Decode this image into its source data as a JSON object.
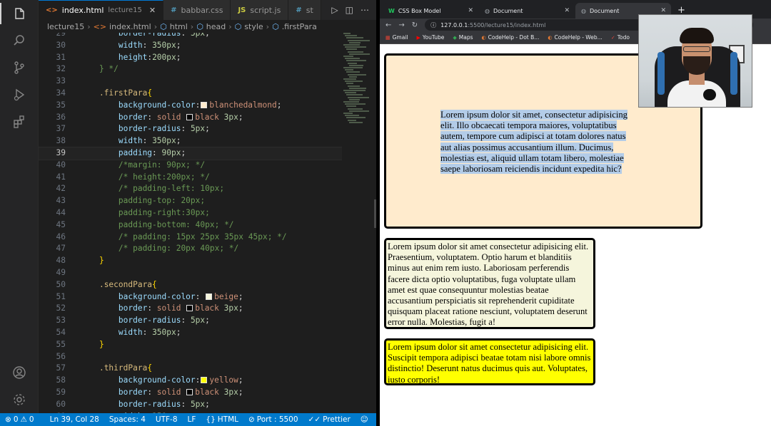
{
  "editor": {
    "tabs": [
      {
        "icon": "<>",
        "label": "index.html",
        "sub": "lecture15",
        "active": true
      },
      {
        "icon": "#",
        "label": "babbar.css",
        "sub": "",
        "active": false
      },
      {
        "icon": "JS",
        "label": "script.js",
        "sub": "",
        "active": false
      },
      {
        "icon": "#",
        "label": "st",
        "sub": "",
        "active": false
      }
    ],
    "breadcrumb": [
      "lecture15",
      "index.html",
      "html",
      "head",
      "style",
      ".firstPara"
    ],
    "lines": [
      {
        "n": "29",
        "indent": "        ",
        "tokens": [
          [
            "prop",
            "border-radius"
          ],
          [
            "punc",
            ": "
          ],
          [
            "num",
            "5px"
          ],
          [
            "punc",
            ";"
          ]
        ]
      },
      {
        "n": "30",
        "indent": "        ",
        "tokens": [
          [
            "prop",
            "width"
          ],
          [
            "punc",
            ": "
          ],
          [
            "num",
            "350px"
          ],
          [
            "punc",
            ";"
          ]
        ]
      },
      {
        "n": "31",
        "indent": "        ",
        "tokens": [
          [
            "prop",
            "height"
          ],
          [
            "punc",
            ":"
          ],
          [
            "num",
            "200px"
          ],
          [
            "punc",
            ";"
          ]
        ]
      },
      {
        "n": "32",
        "indent": "    ",
        "tokens": [
          [
            "com",
            "} */"
          ]
        ]
      },
      {
        "n": "33",
        "indent": "",
        "tokens": []
      },
      {
        "n": "34",
        "indent": "    ",
        "tokens": [
          [
            "sel",
            ".firstPara"
          ],
          [
            "brace",
            "{"
          ]
        ]
      },
      {
        "n": "35",
        "indent": "        ",
        "tokens": [
          [
            "prop",
            "background-color"
          ],
          [
            "punc",
            ":"
          ],
          [
            "swatch",
            "#ffebcd"
          ],
          [
            "val",
            "blanchedalmond"
          ],
          [
            "punc",
            ";"
          ]
        ]
      },
      {
        "n": "36",
        "indent": "        ",
        "tokens": [
          [
            "prop",
            "border"
          ],
          [
            "punc",
            ": "
          ],
          [
            "val",
            "solid "
          ],
          [
            "swatch",
            "#000000"
          ],
          [
            "val",
            "black "
          ],
          [
            "num",
            "3px"
          ],
          [
            "punc",
            ";"
          ]
        ]
      },
      {
        "n": "37",
        "indent": "        ",
        "tokens": [
          [
            "prop",
            "border-radius"
          ],
          [
            "punc",
            ": "
          ],
          [
            "num",
            "5px"
          ],
          [
            "punc",
            ";"
          ]
        ]
      },
      {
        "n": "38",
        "indent": "        ",
        "tokens": [
          [
            "prop",
            "width"
          ],
          [
            "punc",
            ": "
          ],
          [
            "num",
            "350px"
          ],
          [
            "punc",
            ";"
          ]
        ]
      },
      {
        "n": "39",
        "indent": "        ",
        "tokens": [
          [
            "prop",
            "padding"
          ],
          [
            "punc",
            ": "
          ],
          [
            "num",
            "90px"
          ],
          [
            "punc",
            ";"
          ]
        ],
        "current": true
      },
      {
        "n": "40",
        "indent": "        ",
        "tokens": [
          [
            "com",
            "/*margin: 90px; */"
          ]
        ]
      },
      {
        "n": "41",
        "indent": "        ",
        "tokens": [
          [
            "com",
            "/* height:200px; */"
          ]
        ]
      },
      {
        "n": "42",
        "indent": "        ",
        "tokens": [
          [
            "com",
            "/* padding-left: 10px;"
          ]
        ]
      },
      {
        "n": "43",
        "indent": "        ",
        "tokens": [
          [
            "com",
            "padding-top: 20px;"
          ]
        ]
      },
      {
        "n": "44",
        "indent": "        ",
        "tokens": [
          [
            "com",
            "padding-right:30px;"
          ]
        ]
      },
      {
        "n": "45",
        "indent": "        ",
        "tokens": [
          [
            "com",
            "padding-bottom: 40px; */"
          ]
        ]
      },
      {
        "n": "46",
        "indent": "        ",
        "tokens": [
          [
            "com",
            "/* padding: 15px 25px 35px 45px; */"
          ]
        ]
      },
      {
        "n": "47",
        "indent": "        ",
        "tokens": [
          [
            "com",
            "/* padding: 20px 40px; */"
          ]
        ]
      },
      {
        "n": "48",
        "indent": "    ",
        "tokens": [
          [
            "brace",
            "}"
          ]
        ]
      },
      {
        "n": "49",
        "indent": "",
        "tokens": []
      },
      {
        "n": "50",
        "indent": "    ",
        "tokens": [
          [
            "sel",
            ".secondPara"
          ],
          [
            "brace",
            "{"
          ]
        ]
      },
      {
        "n": "51",
        "indent": "        ",
        "tokens": [
          [
            "prop",
            "background-color"
          ],
          [
            "punc",
            ": "
          ],
          [
            "swatch",
            "#f5f5dc"
          ],
          [
            "val",
            "beige"
          ],
          [
            "punc",
            ";"
          ]
        ]
      },
      {
        "n": "52",
        "indent": "        ",
        "tokens": [
          [
            "prop",
            "border"
          ],
          [
            "punc",
            ": "
          ],
          [
            "val",
            "solid "
          ],
          [
            "swatch",
            "#000000"
          ],
          [
            "val",
            "black "
          ],
          [
            "num",
            "3px"
          ],
          [
            "punc",
            ";"
          ]
        ]
      },
      {
        "n": "53",
        "indent": "        ",
        "tokens": [
          [
            "prop",
            "border-radius"
          ],
          [
            "punc",
            ": "
          ],
          [
            "num",
            "5px"
          ],
          [
            "punc",
            ";"
          ]
        ]
      },
      {
        "n": "54",
        "indent": "        ",
        "tokens": [
          [
            "prop",
            "width"
          ],
          [
            "punc",
            ": "
          ],
          [
            "num",
            "350px"
          ],
          [
            "punc",
            ";"
          ]
        ]
      },
      {
        "n": "55",
        "indent": "    ",
        "tokens": [
          [
            "brace",
            "}"
          ]
        ]
      },
      {
        "n": "56",
        "indent": "",
        "tokens": []
      },
      {
        "n": "57",
        "indent": "    ",
        "tokens": [
          [
            "sel",
            ".thirdPara"
          ],
          [
            "brace",
            "{"
          ]
        ]
      },
      {
        "n": "58",
        "indent": "        ",
        "tokens": [
          [
            "prop",
            "background-color"
          ],
          [
            "punc",
            ":"
          ],
          [
            "swatch",
            "#ffff00"
          ],
          [
            "val",
            "yellow"
          ],
          [
            "punc",
            ";"
          ]
        ]
      },
      {
        "n": "59",
        "indent": "        ",
        "tokens": [
          [
            "prop",
            "border"
          ],
          [
            "punc",
            ": "
          ],
          [
            "val",
            "solid "
          ],
          [
            "swatch",
            "#000000"
          ],
          [
            "val",
            "black "
          ],
          [
            "num",
            "3px"
          ],
          [
            "punc",
            ";"
          ]
        ]
      },
      {
        "n": "60",
        "indent": "        ",
        "tokens": [
          [
            "prop",
            "border-radius"
          ],
          [
            "punc",
            ": "
          ],
          [
            "num",
            "5px"
          ],
          [
            "punc",
            ";"
          ]
        ]
      },
      {
        "n": "61",
        "indent": "        ",
        "tokens": [
          [
            "prop",
            "width"
          ],
          [
            "punc",
            ": "
          ],
          [
            "num",
            "350px"
          ],
          [
            "punc",
            ";"
          ]
        ]
      }
    ],
    "status": {
      "errors": "0",
      "warnings": "0",
      "position": "Ln 39, Col 28",
      "spaces": "Spaces: 4",
      "encoding": "UTF-8",
      "eol": "LF",
      "language": "HTML",
      "port": "Port : 5500",
      "prettier": "Prettier"
    }
  },
  "browser": {
    "tabs": [
      {
        "favicon": "W",
        "title": "CSS Box Model",
        "active": false
      },
      {
        "favicon": "◍",
        "title": "Document",
        "active": false
      },
      {
        "favicon": "◍",
        "title": "Document",
        "active": true
      }
    ],
    "url_host": "127.0.0.1",
    "url_path": ":5500/lecture15/index.html",
    "bookmarks": [
      {
        "icon": "▦",
        "label": "Gmail"
      },
      {
        "icon": "▶",
        "label": "YouTube"
      },
      {
        "icon": "◆",
        "label": "Maps"
      },
      {
        "icon": "◐",
        "label": "CodeHelp - Dot B..."
      },
      {
        "icon": "◐",
        "label": "CodeHelp - Web..."
      },
      {
        "icon": "✓",
        "label": "Todo"
      }
    ],
    "paragraphs": {
      "first": "Lorem ipsum dolor sit amet, consectetur adipisicing elit. Illo obcaecati tempora maiores, voluptatibus autem, tempore cum adipisci at totam dolores natus aut alias possimus accusantium illum. Ducimus, molestias est, aliquid ullam totam libero, molestiae saepe laboriosam reiciendis incidunt expedita hic?",
      "second": "Lorem ipsum dolor sit amet consectetur adipisicing elit. Praesentium, voluptatem. Optio harum et blanditiis minus aut enim rem iusto. Laboriosam perferendis facere dicta optio voluptatibus, fuga voluptate ullam amet est quae consequuntur molestias beatae accusantium perspiciatis sit reprehenderit cupiditate quisquam placeat ratione nesciunt, voluptatem deserunt error nulla. Molestias, fugit a!",
      "third": "Lorem ipsum dolor sit amet consectetur adipisicing elit. Suscipit tempora adipisci beatae totam nisi labore omnis distinctio! Deserunt natus ducimus quis aut. Voluptates, iusto corporis!"
    },
    "colors": {
      "first_bg": "#ffebcd",
      "second_bg": "#f5f5dc",
      "third_bg": "#ffff00",
      "selection": "#b3cce8"
    }
  }
}
